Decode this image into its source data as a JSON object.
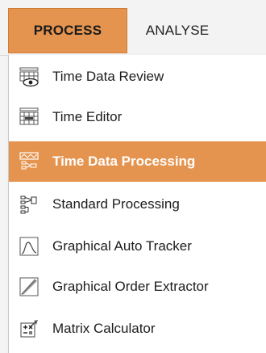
{
  "tabs": {
    "process_label": "PROCESS",
    "analyse_label": "ANALYSE"
  },
  "menu": {
    "items": [
      {
        "label": "Time Data Review",
        "icon": "time-data-review-icon"
      },
      {
        "label": "Time Editor",
        "icon": "time-editor-icon"
      },
      {
        "label": "Time Data Processing",
        "icon": "time-data-processing-icon",
        "highlighted": true
      },
      {
        "label": "Standard Processing",
        "icon": "standard-processing-icon"
      },
      {
        "label": "Graphical Auto Tracker",
        "icon": "graphical-auto-tracker-icon"
      },
      {
        "label": "Graphical Order Extractor",
        "icon": "graphical-order-extractor-icon"
      },
      {
        "label": "Matrix Calculator",
        "icon": "matrix-calculator-icon"
      }
    ]
  },
  "colors": {
    "accent": "#e5944f",
    "menu_bg": "#ffffff",
    "text": "#1c1c1c"
  }
}
